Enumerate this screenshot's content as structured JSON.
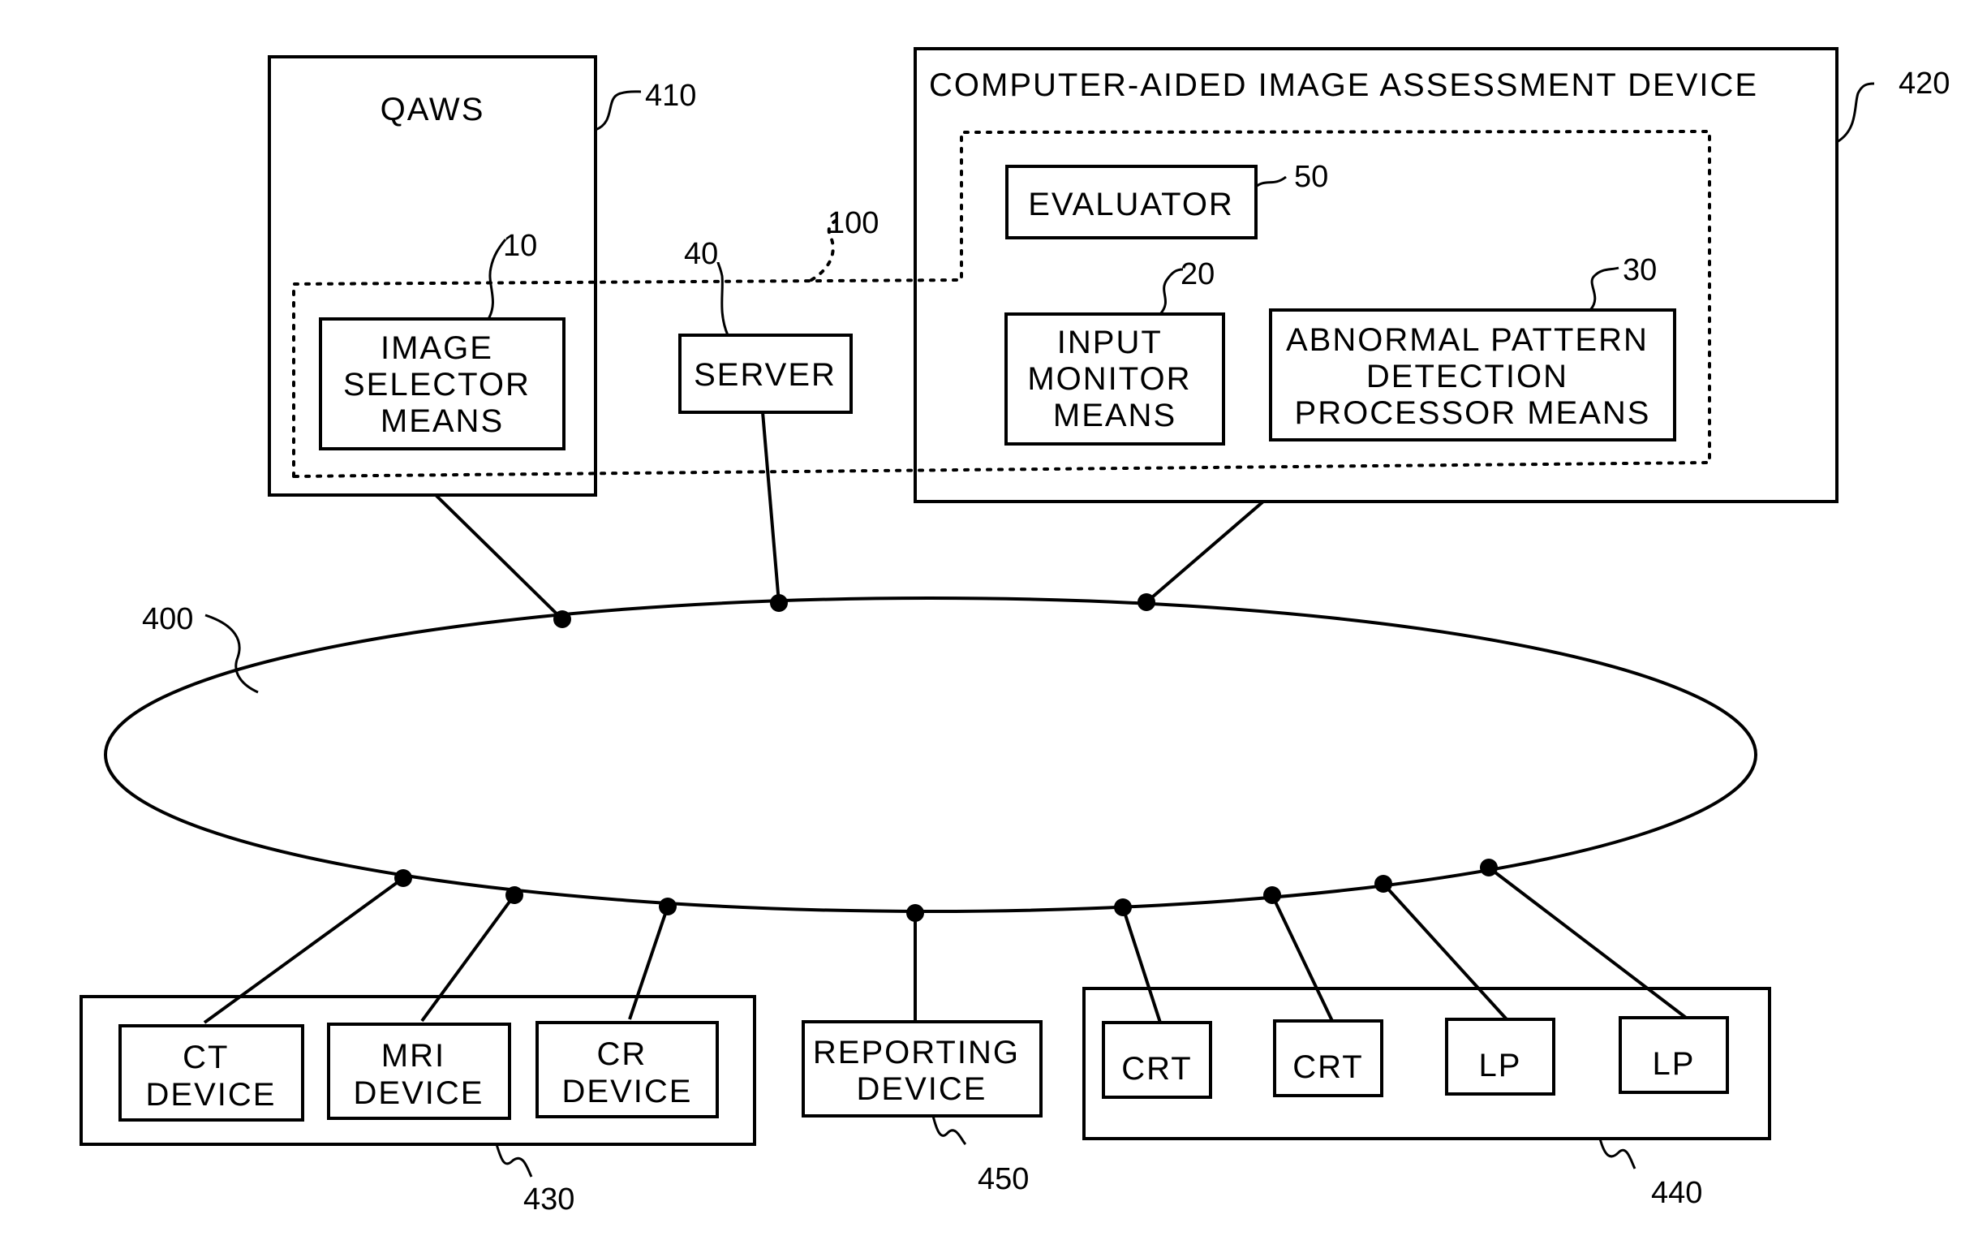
{
  "figure": {
    "network_ref": "400",
    "common_ref": "100",
    "qaws": {
      "title": "QAWS",
      "ref": "410"
    },
    "image_selector": {
      "lines": [
        "IMAGE",
        "SELECTOR",
        "MEANS"
      ],
      "ref": "10"
    },
    "server": {
      "label": "SERVER",
      "ref": "40"
    },
    "assessment_device": {
      "title": "COMPUTER-AIDED IMAGE ASSESSMENT DEVICE",
      "ref": "420"
    },
    "evaluator": {
      "label": "EVALUATOR",
      "ref": "50"
    },
    "input_monitor": {
      "lines": [
        "INPUT",
        "MONITOR",
        "MEANS"
      ],
      "ref": "20"
    },
    "abnormal_detection": {
      "lines": [
        "ABNORMAL PATTERN",
        "DETECTION",
        "PROCESSOR MEANS"
      ],
      "ref": "30"
    },
    "modalities": {
      "ref": "430",
      "devices": [
        {
          "lines": [
            "CT",
            "DEVICE"
          ]
        },
        {
          "lines": [
            "MRI",
            "DEVICE"
          ]
        },
        {
          "lines": [
            "CR",
            "DEVICE"
          ]
        }
      ]
    },
    "reporting": {
      "lines": [
        "REPORTING",
        "DEVICE"
      ],
      "ref": "450"
    },
    "outputs": {
      "ref": "440",
      "devices": [
        {
          "label": "CRT"
        },
        {
          "label": "CRT"
        },
        {
          "label": "LP"
        },
        {
          "label": "LP"
        }
      ]
    }
  }
}
